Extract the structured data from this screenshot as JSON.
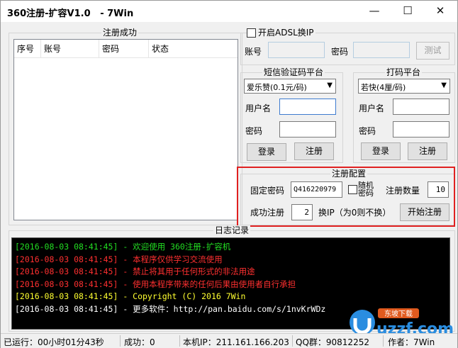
{
  "window": {
    "title": "360注册-扩容V1.0   - 7Win",
    "minimize": "—",
    "maximize": "☐",
    "close": "✕"
  },
  "success_group": {
    "title": "注册成功",
    "columns": [
      "序号",
      "账号",
      "密码",
      "状态"
    ],
    "rows": []
  },
  "adsl": {
    "checkbox_label": "开启ADSL换IP",
    "checked": false,
    "account_label": "账号",
    "account_value": "",
    "password_label": "密码",
    "password_value": "",
    "test_button": "测试"
  },
  "sms_platform": {
    "title": "短信验证码平台",
    "selected": "爱乐赞(0.1元/码)",
    "username_label": "用户名",
    "username_value": "",
    "password_label": "密码",
    "password_value": "",
    "login_button": "登录",
    "register_button": "注册"
  },
  "captcha_platform": {
    "title": "打码平台",
    "selected": "若快(4厘/码)",
    "username_label": "用户名",
    "username_value": "",
    "password_label": "密码",
    "password_value": "",
    "login_button": "登录",
    "register_button": "注册"
  },
  "reg_config": {
    "title": "注册配置",
    "fixed_password_label": "固定密码",
    "fixed_password_value": "Q416220979",
    "random_password_label": "随机密码",
    "random_checked": false,
    "count_label": "注册数量",
    "count_value": "10",
    "success_label": "成功注册",
    "success_value": "2",
    "change_ip_label": "换IP（为0则不换）",
    "start_button": "开始注册"
  },
  "log": {
    "title": "日志记录",
    "lines": [
      {
        "text": "[2016-08-03 08:41:45] - 欢迎使用 360注册-扩容机",
        "color": "#22dd22"
      },
      {
        "text": "[2016-08-03 08:41:45] - 本程序仅供学习交流使用",
        "color": "#ff3030"
      },
      {
        "text": "[2016-08-03 08:41:45] - 禁止将其用于任何形式的非法用途",
        "color": "#ff3030"
      },
      {
        "text": "[2016-08-03 08:41:45] - 使用本程序带来的任何后果由使用者自行承担",
        "color": "#ff3030"
      },
      {
        "text": "[2016-08-03 08:41:45] - Copyright (C) 2016 7Win",
        "color": "#ffff30"
      },
      {
        "text": "[2016-08-03 08:41:45] - 更多软件：http://pan.baidu.com/s/1nvKrWDz",
        "color": "#ffffff"
      }
    ]
  },
  "status_bar": {
    "runtime": "已运行：00小时01分43秒",
    "success": "成功：0",
    "local_ip": "本机IP：211.161.166.203",
    "qq_group": "QQ群：90812252",
    "author": "作者：7Win"
  },
  "watermark": {
    "text": "uzzf.com",
    "sub": "东坡下载"
  },
  "colors": {
    "highlight_box": "#e02020",
    "log_background": "#000000"
  }
}
